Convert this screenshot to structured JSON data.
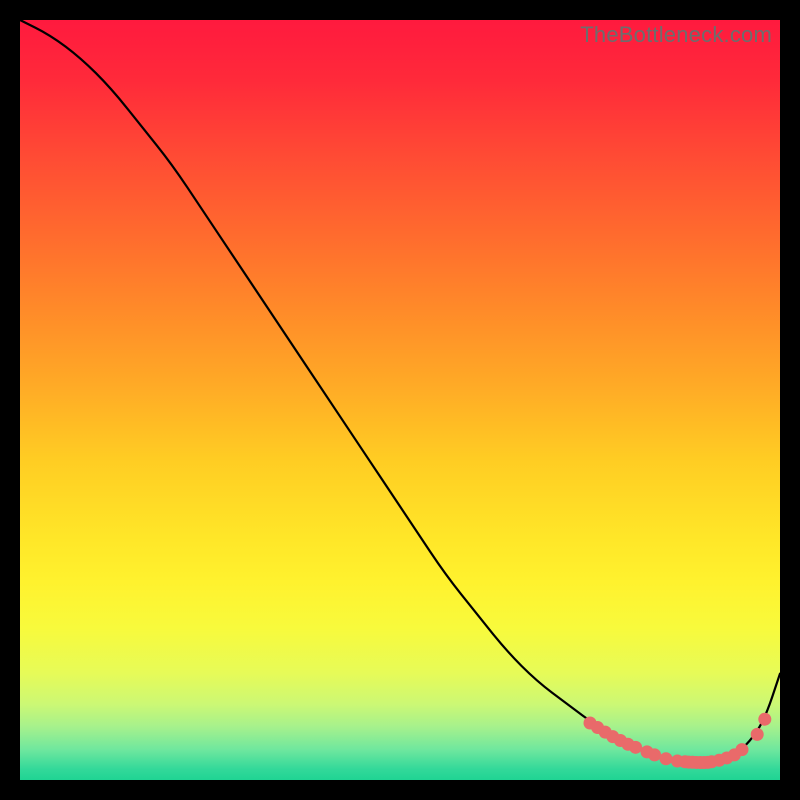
{
  "watermark": "TheBottleneck.com",
  "chart_data": {
    "type": "line",
    "title": "",
    "xlabel": "",
    "ylabel": "",
    "xlim": [
      0,
      100
    ],
    "ylim": [
      0,
      100
    ],
    "grid": false,
    "series": [
      {
        "name": "curve",
        "x": [
          0,
          4,
          8,
          12,
          16,
          20,
          24,
          28,
          32,
          36,
          40,
          44,
          48,
          52,
          56,
          60,
          64,
          68,
          72,
          76,
          80,
          82,
          84,
          86,
          88,
          90,
          92,
          94,
          96,
          98,
          100
        ],
        "y": [
          100,
          98,
          95,
          91,
          86,
          81,
          75,
          69,
          63,
          57,
          51,
          45,
          39,
          33,
          27,
          22,
          17,
          13,
          10,
          7,
          5,
          4,
          3,
          2.5,
          2.3,
          2.3,
          2.6,
          3.3,
          5,
          8,
          14
        ]
      }
    ],
    "markers": [
      {
        "x": 75,
        "y": 7.5
      },
      {
        "x": 76,
        "y": 6.9
      },
      {
        "x": 77,
        "y": 6.3
      },
      {
        "x": 78,
        "y": 5.7
      },
      {
        "x": 79,
        "y": 5.2
      },
      {
        "x": 80,
        "y": 4.7
      },
      {
        "x": 81,
        "y": 4.3
      },
      {
        "x": 82.5,
        "y": 3.7
      },
      {
        "x": 83.5,
        "y": 3.3
      },
      {
        "x": 85,
        "y": 2.8
      },
      {
        "x": 86.5,
        "y": 2.5
      },
      {
        "x": 87.5,
        "y": 2.4
      },
      {
        "x": 88,
        "y": 2.35
      },
      {
        "x": 88.5,
        "y": 2.33
      },
      {
        "x": 89,
        "y": 2.31
      },
      {
        "x": 89.5,
        "y": 2.3
      },
      {
        "x": 90,
        "y": 2.3
      },
      {
        "x": 90.5,
        "y": 2.32
      },
      {
        "x": 91,
        "y": 2.4
      },
      {
        "x": 92,
        "y": 2.6
      },
      {
        "x": 93,
        "y": 2.9
      },
      {
        "x": 94,
        "y": 3.3
      },
      {
        "x": 95,
        "y": 4
      },
      {
        "x": 97,
        "y": 6
      },
      {
        "x": 98,
        "y": 8
      }
    ],
    "gradient_stops": [
      {
        "pos": 0.0,
        "color": "#ff1a3e"
      },
      {
        "pos": 0.08,
        "color": "#ff2a3a"
      },
      {
        "pos": 0.18,
        "color": "#ff4b34"
      },
      {
        "pos": 0.28,
        "color": "#ff6a2e"
      },
      {
        "pos": 0.38,
        "color": "#ff8a29"
      },
      {
        "pos": 0.48,
        "color": "#ffaa26"
      },
      {
        "pos": 0.58,
        "color": "#ffcd23"
      },
      {
        "pos": 0.68,
        "color": "#ffe628"
      },
      {
        "pos": 0.74,
        "color": "#fff22e"
      },
      {
        "pos": 0.8,
        "color": "#f8fa3c"
      },
      {
        "pos": 0.86,
        "color": "#e6fb58"
      },
      {
        "pos": 0.9,
        "color": "#ccf874"
      },
      {
        "pos": 0.93,
        "color": "#a6f18c"
      },
      {
        "pos": 0.96,
        "color": "#6fe79e"
      },
      {
        "pos": 0.985,
        "color": "#34d99a"
      },
      {
        "pos": 1.0,
        "color": "#1fd493"
      }
    ],
    "curve_color": "#000000",
    "marker_color": "#e96a6a"
  }
}
